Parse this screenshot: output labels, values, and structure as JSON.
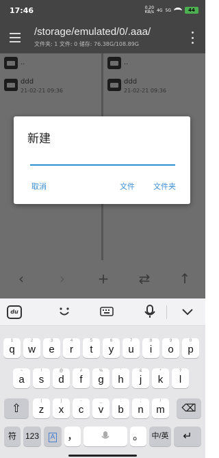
{
  "status_bar": {
    "time": "17:46",
    "speed_value": "0.20",
    "speed_unit": "KB/s",
    "network_a": "4G",
    "network_b": "5G",
    "battery": "44"
  },
  "app_bar": {
    "path": "/storage/emulated/0/.aaa/",
    "info": "文件夹: 1  文件: 0  储存: 76.38G/108.89G"
  },
  "panes": {
    "left": {
      "items": [
        {
          "name": "..",
          "date": ""
        },
        {
          "name": "ddd",
          "date": "21-02-21 09:36"
        }
      ]
    },
    "right": {
      "items": [
        {
          "name": "..",
          "date": ""
        },
        {
          "name": "ddd",
          "date": "21-02-21 09:36"
        }
      ]
    }
  },
  "toolbar": {
    "back": "‹",
    "forward": "›",
    "add": "+",
    "swap": "⇄",
    "up": "↑"
  },
  "dialog": {
    "title": "新建",
    "input_value": "",
    "cancel": "取消",
    "file": "文件",
    "folder": "文件夹"
  },
  "keyboard": {
    "top_icons": [
      "du-logo",
      "emoji-icon",
      "keyboard-icon",
      "microphone-icon",
      "chevron-down-icon"
    ],
    "du_label": "du",
    "row1": [
      {
        "main": "q",
        "sub": "1"
      },
      {
        "main": "w",
        "sub": "2"
      },
      {
        "main": "e",
        "sub": "3"
      },
      {
        "main": "r",
        "sub": "4"
      },
      {
        "main": "t",
        "sub": "5"
      },
      {
        "main": "y",
        "sub": "6"
      },
      {
        "main": "u",
        "sub": "7"
      },
      {
        "main": "i",
        "sub": "8"
      },
      {
        "main": "o",
        "sub": "9"
      },
      {
        "main": "p",
        "sub": "0"
      }
    ],
    "row2": [
      {
        "main": "a",
        "sub": "~"
      },
      {
        "main": "s",
        "sub": "!"
      },
      {
        "main": "d",
        "sub": "@"
      },
      {
        "main": "f",
        "sub": "#"
      },
      {
        "main": "g",
        "sub": "%"
      },
      {
        "main": "h",
        "sub": "'"
      },
      {
        "main": "j",
        "sub": "&"
      },
      {
        "main": "k",
        "sub": "*"
      },
      {
        "main": "l",
        "sub": "?"
      }
    ],
    "row3": [
      {
        "main": "z",
        "sub": "("
      },
      {
        "main": "x",
        "sub": ")"
      },
      {
        "main": "c",
        "sub": "-"
      },
      {
        "main": "v",
        "sub": "_"
      },
      {
        "main": "b",
        "sub": ":"
      },
      {
        "main": "n",
        "sub": ";"
      },
      {
        "main": "m",
        "sub": "/"
      }
    ],
    "symbol_key": "符",
    "num_key": "123",
    "lang_key": "A",
    "comma_key": "，",
    "period_key": "。",
    "cn_en_key": "中/英",
    "shift_glyph": "⇧",
    "delete_glyph": "⌫",
    "enter_glyph": "↵"
  }
}
